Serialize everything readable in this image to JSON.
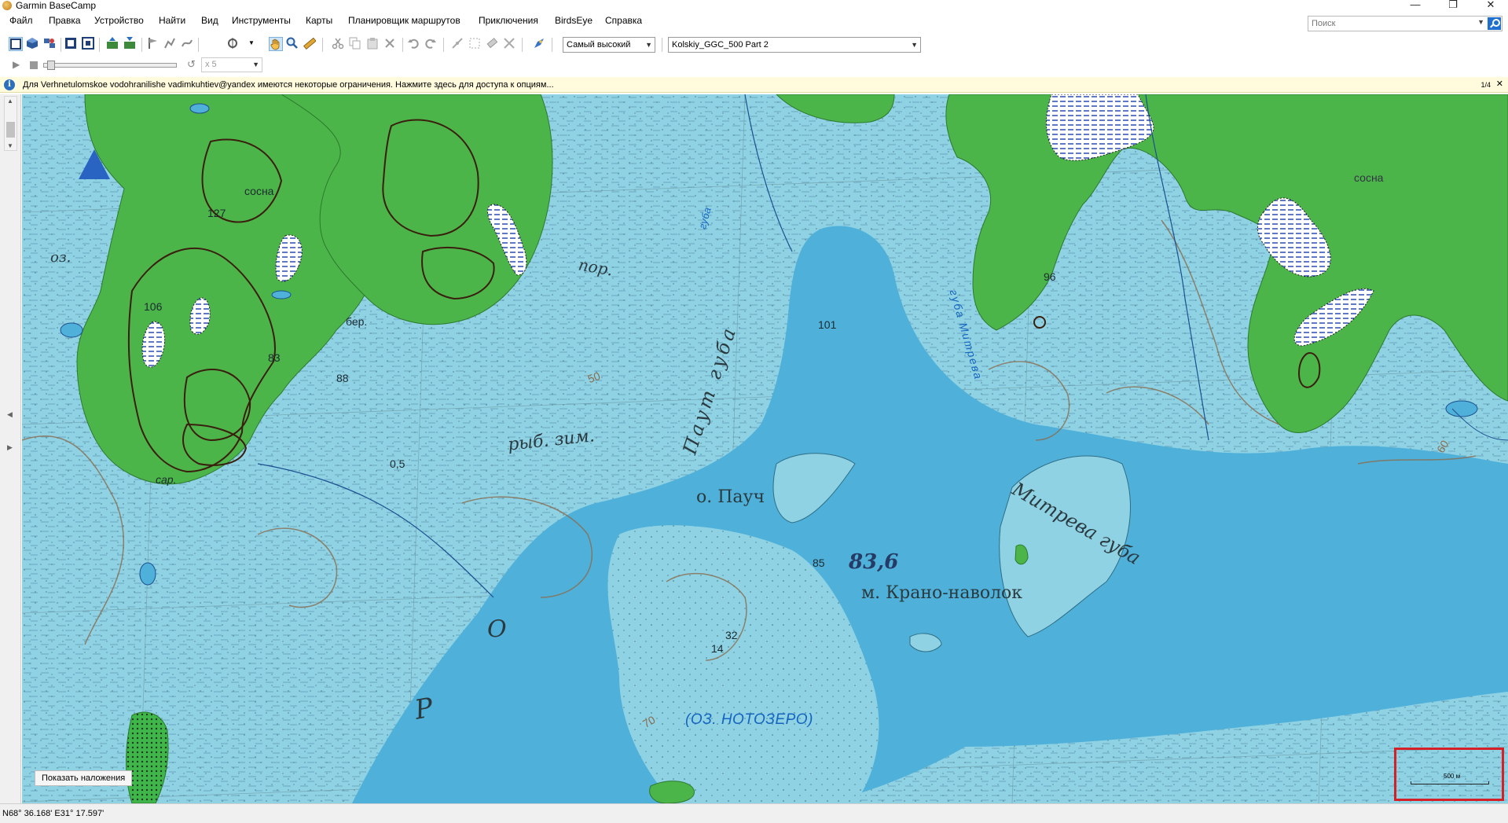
{
  "window": {
    "title": "Garmin BaseCamp",
    "controls": [
      "—",
      "❐",
      "✕"
    ]
  },
  "menu": [
    "Файл",
    "Правка",
    "Устройство",
    "Найти",
    "Вид",
    "Инструменты",
    "Карты",
    "Планировщик маршрутов",
    "Приключения",
    "BirdsEye",
    "Справка"
  ],
  "search": {
    "placeholder": "Поиск"
  },
  "toolbar": {
    "detail_level": "Самый высокий",
    "map_product": "Kolskiy_GGC_500 Part 2",
    "speed": "x 5"
  },
  "infobar": {
    "message": "Для Verhnetulomskoe vodohranilishe vadimkuhtiev@yandex имеются некоторые ограничения. Нажмите здесь для доступа к опциям...",
    "pager": "1/4",
    "close": "✕"
  },
  "map": {
    "show_overlays_button": "Показать наложения",
    "scale_label": "500 м",
    "labels": {
      "sosna_top": "сосна",
      "sosna_right": "сосна",
      "h127": "127",
      "h106": "106",
      "h83": "83",
      "h88": "88",
      "ber": "бер.",
      "sar": "сар.",
      "oz": "оз.",
      "por": "пор.",
      "guba_top": "губа",
      "pautguba": "Паут губа",
      "ryb_zim": "рыб. зим.",
      "depth05": "0,5",
      "h50": "50",
      "o_pauch": "о. Пауч",
      "h101": "101",
      "h96": "96",
      "guba_mitreva": "губа Митрева",
      "mitreva_guba": "Митрева губа",
      "h85": "85",
      "h83_6": "83,6",
      "m_krano": "м. Крано-наволок",
      "h32": "32",
      "h14": "14",
      "big_o": "О",
      "big_r": "Р",
      "h70": "70",
      "h60": "60",
      "noto": "(ОЗ. НОТОЗЕРО)"
    }
  },
  "status": {
    "coordinates": "N68° 36.168' E31° 17.597'"
  }
}
